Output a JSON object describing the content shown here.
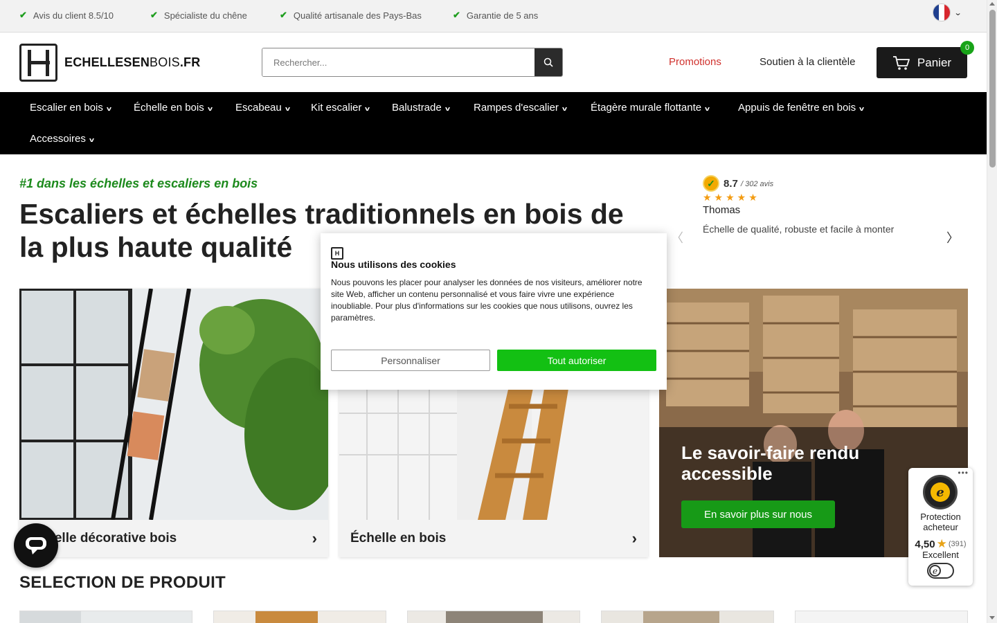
{
  "usp_bar": {
    "items": [
      "Avis du client 8.5/10",
      "Spécialiste du chêne",
      "Qualité artisanale des Pays-Bas",
      "Garantie de 5 ans"
    ],
    "language_icon": "flag-fr-icon"
  },
  "header": {
    "logo_bold": "ECHELLESEN",
    "logo_thin": "BOIS",
    "logo_tld": ".FR",
    "search_placeholder": "Rechercher...",
    "promotions": "Promotions",
    "support": "Soutien à la clientèle",
    "cart_label": "Panier",
    "cart_count": "0"
  },
  "nav": {
    "items": [
      "Escalier en bois",
      "Échelle en bois",
      "Escabeau",
      "Kit escalier",
      "Balustrade",
      "Rampes d'escalier",
      "Étagère murale flottante",
      "Appuis de fenêtre en bois",
      "Accessoires"
    ]
  },
  "hero": {
    "kicker": "#1 dans les échelles et escaliers en bois",
    "title": "Escaliers et échelles traditionnels en bois de la plus haute qualité"
  },
  "review": {
    "score": "8.7",
    "count": "/ 302 avis",
    "stars": "★★★★★",
    "name": "Thomas",
    "text": "Échelle de qualité, robuste et facile à monter"
  },
  "tiles": [
    {
      "title": "Échelle décorative bois"
    },
    {
      "title": "Échelle en bois"
    }
  ],
  "feature_tile": {
    "title": "Le savoir-faire rendu accessible",
    "button": "En savoir plus sur nous"
  },
  "section": {
    "title": "SELECTION DE PRODUIT"
  },
  "trusted_shops": {
    "label": "Protection acheteur",
    "rating": "4,50",
    "count": "(391)",
    "grade": "Excellent"
  },
  "cookie": {
    "title": "Nous utilisons des cookies",
    "body": "Nous pouvons les placer pour analyser les données de nos visiteurs, améliorer notre site Web, afficher un contenu personnalisé et vous faire vivre une expérience inoubliable. Pour plus d'informations sur les cookies que nous utilisons, ouvrez les paramètres.",
    "customize": "Personnaliser",
    "accept": "Tout autoriser"
  },
  "colors": {
    "accent_green": "#1c8a1c",
    "promo_red": "#d0312d",
    "nav_bg": "#000000",
    "accept_green": "#13c013"
  }
}
